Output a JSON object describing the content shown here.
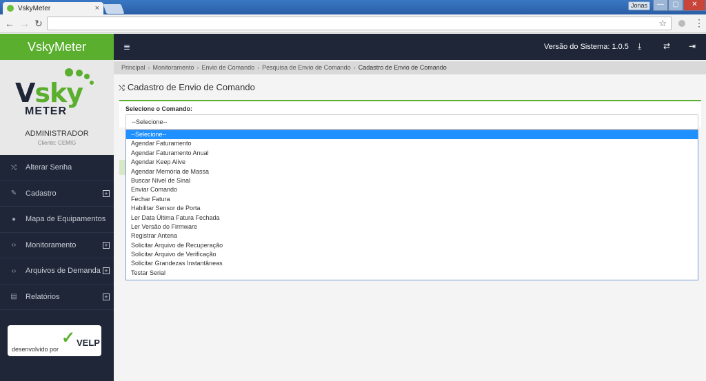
{
  "browser": {
    "tab_title": "VskyMeter",
    "tab_close": "×",
    "user": "Jonas",
    "win_min": "—",
    "win_max": "▢",
    "win_close": "✕"
  },
  "sidebar": {
    "brand": "VskyMeter",
    "logo_sky": "sky",
    "logo_v": "V",
    "logo_meter": "METER",
    "profile_name": "ADMINISTRADOR",
    "profile_client": "Cliente: CEMIG",
    "items": [
      {
        "label": "Alterar Senha",
        "icon": "shuffle-icon",
        "glyph": "⤭",
        "expandable": false
      },
      {
        "label": "Cadastro",
        "icon": "edit-icon",
        "glyph": "✎",
        "expandable": true
      },
      {
        "label": "Mapa de Equipamentos",
        "icon": "globe-icon",
        "glyph": "●",
        "expandable": false
      },
      {
        "label": "Monitoramento",
        "icon": "code-icon",
        "glyph": "‹›",
        "expandable": true
      },
      {
        "label": "Arquivos de Demanda",
        "icon": "code-icon",
        "glyph": "‹›",
        "expandable": true
      },
      {
        "label": "Relatórios",
        "icon": "file-icon",
        "glyph": "▤",
        "expandable": true
      }
    ],
    "expand_glyph": "+",
    "footer_developed_by": "desenvolvido por",
    "footer_company": "VELP",
    "footer_check": "✓"
  },
  "topbar": {
    "menu_icon": "≣",
    "version_label": "Versão do Sistema: 1.0.5",
    "download_icon": "⤓",
    "switch_icon": "⇄",
    "logout_icon": "⇥"
  },
  "breadcrumb": [
    "Principal",
    "Monitoramento",
    "Envio de Comando",
    "Pesquisa de Envio de Comando",
    "Cadastro de Envio de Comando"
  ],
  "breadcrumb_sep": "›",
  "page": {
    "title_icon": "⤭",
    "title": "Cadastro de Envio de Comando",
    "select_label": "Selecione o Comando:",
    "select_value": "--Selecione--"
  },
  "dropdown_options": [
    "--Selecione--",
    "Agendar Faturamento",
    "Agendar Faturamento Anual",
    "Agendar Keep Alive",
    "Agendar Memória de Massa",
    "Buscar Nível de Sinal",
    "Enviar Comando",
    "Fechar Fatura",
    "Habilitar Sensor de Porta",
    "Ler Data Última Fatura Fechada",
    "Ler Versão do Firmware",
    "Registrar Antena",
    "Solicitar Arquivo de Recuperação",
    "Solicitar Arquivo de Verificação",
    "Solicitar Grandezas Instantâneas",
    "Testar Serial"
  ],
  "colors": {
    "brand_green": "#5aaf2e",
    "dark_navy": "#1e2638",
    "selection_blue": "#1e90ff"
  }
}
